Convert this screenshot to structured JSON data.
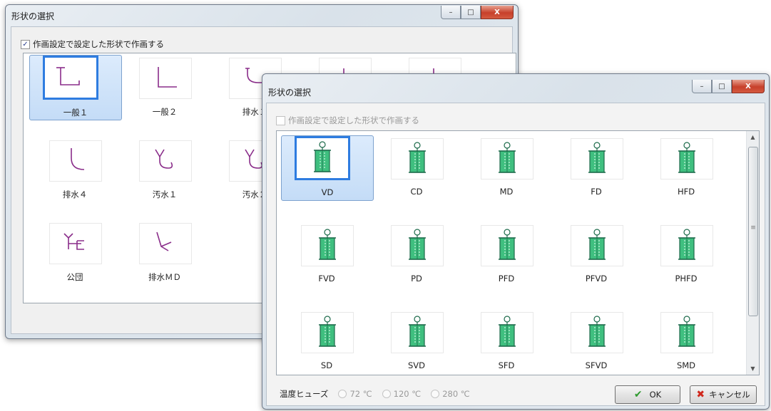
{
  "back_window": {
    "title": "形状の選択",
    "checkbox_label": "作画設定で設定した形状で作画する",
    "checkbox_checked": "✓",
    "tiles": [
      {
        "label": "一般１",
        "icon": "general1-icon",
        "selected": true
      },
      {
        "label": "一般２",
        "icon": "general2-icon"
      },
      {
        "label": "排水１",
        "icon": "drain1-icon"
      },
      {
        "label": "",
        "icon": "partial-icon"
      },
      {
        "label": "",
        "icon": "partial-icon"
      },
      {
        "label": "排水４",
        "icon": "drain4-icon"
      },
      {
        "label": "汚水１",
        "icon": "sewage1-icon"
      },
      {
        "label": "汚水２",
        "icon": "sewage2-icon"
      },
      {
        "label": "公団",
        "icon": "kodan-icon"
      },
      {
        "label": "排水ＭＤ",
        "icon": "drain-md-icon"
      }
    ]
  },
  "front_window": {
    "title": "形状の選択",
    "checkbox_label": "作画設定で設定した形状で作画する",
    "tiles": [
      "VD",
      "CD",
      "MD",
      "FD",
      "HFD",
      "FVD",
      "PD",
      "PFD",
      "PFVD",
      "PHFD",
      "SD",
      "SVD",
      "SFD",
      "SFVD",
      "SMD"
    ],
    "selected_tile": "VD",
    "fuse_label": "温度ヒューズ",
    "fuse_options": [
      "72 ℃",
      "120 ℃",
      "280 ℃"
    ],
    "ok_label": "OK",
    "cancel_label": "キャンセル"
  },
  "window_controls": {
    "minimize": "–",
    "maximize": "□",
    "close": "X"
  },
  "colors": {
    "selection_border": "#2e7ce0",
    "damper_green": "#3fbf7f",
    "pipe_purple": "#8a2d8a"
  }
}
